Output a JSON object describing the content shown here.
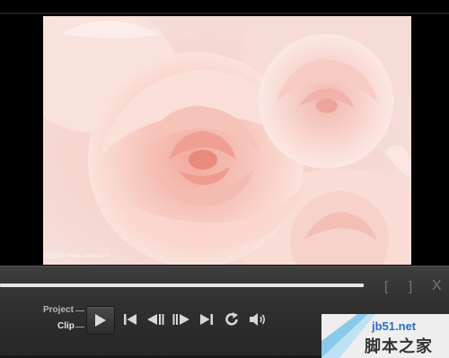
{
  "preview": {
    "watermark_text": "昵图网 www.nipic.com"
  },
  "scrub": {
    "mark_in": "[",
    "mark_out": "]",
    "close_glyph": "X",
    "progress_fraction": 0.81
  },
  "playback": {
    "mode_project": "Project",
    "mode_clip": "Clip",
    "buttons": [
      {
        "icon": "play-icon"
      },
      {
        "icon": "skip-to-start-icon"
      },
      {
        "icon": "previous-frame-icon"
      },
      {
        "icon": "next-frame-icon"
      },
      {
        "icon": "skip-to-end-icon"
      },
      {
        "icon": "repeat-icon"
      },
      {
        "icon": "volume-icon"
      }
    ]
  },
  "site_watermark": {
    "url": "jb51.net",
    "name": "脚本之家"
  },
  "colors": {
    "background": "#0b0b0b",
    "control_bar": "#2e2e2e",
    "icon": "#d8d8d8",
    "site_url": "#2a6fc0"
  }
}
